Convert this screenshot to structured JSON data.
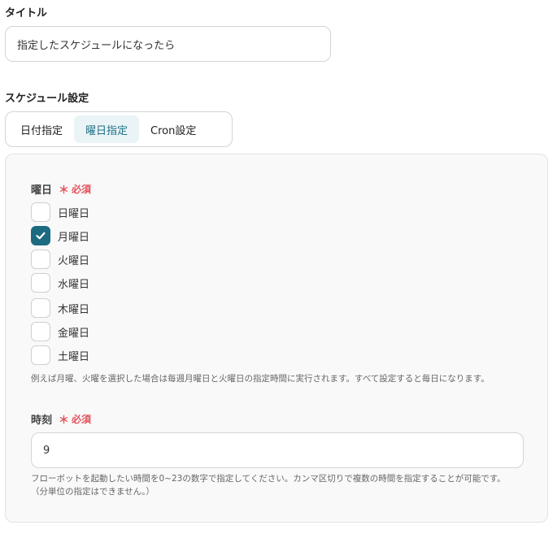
{
  "title_field": {
    "label": "タイトル",
    "value": "指定したスケジュールになったら"
  },
  "schedule": {
    "label": "スケジュール設定",
    "tabs": [
      {
        "label": "日付指定",
        "active": false
      },
      {
        "label": "曜日指定",
        "active": true
      },
      {
        "label": "Cron設定",
        "active": false
      }
    ]
  },
  "weekday": {
    "label": "曜日",
    "required_mark": "＊",
    "required_label": "必須",
    "options": [
      {
        "label": "日曜日",
        "checked": false
      },
      {
        "label": "月曜日",
        "checked": true
      },
      {
        "label": "火曜日",
        "checked": false
      },
      {
        "label": "水曜日",
        "checked": false
      },
      {
        "label": "木曜日",
        "checked": false
      },
      {
        "label": "金曜日",
        "checked": false
      },
      {
        "label": "土曜日",
        "checked": false
      }
    ],
    "help": "例えば月曜、火曜を選択した場合は毎週月曜日と火曜日の指定時間に実行されます。すべて設定すると毎日になります。"
  },
  "time": {
    "label": "時刻",
    "required_mark": "＊",
    "required_label": "必須",
    "value": "9",
    "help_line1": "フローボットを起動したい時間を0~23の数字で指定してください。カンマ区切りで複数の時間を指定することが可能です。",
    "help_line2": "（分単位の指定はできません。）"
  },
  "colors": {
    "accent": "#1c6b81",
    "required": "#e0525b",
    "tab_active_bg": "#eaf4f6"
  }
}
